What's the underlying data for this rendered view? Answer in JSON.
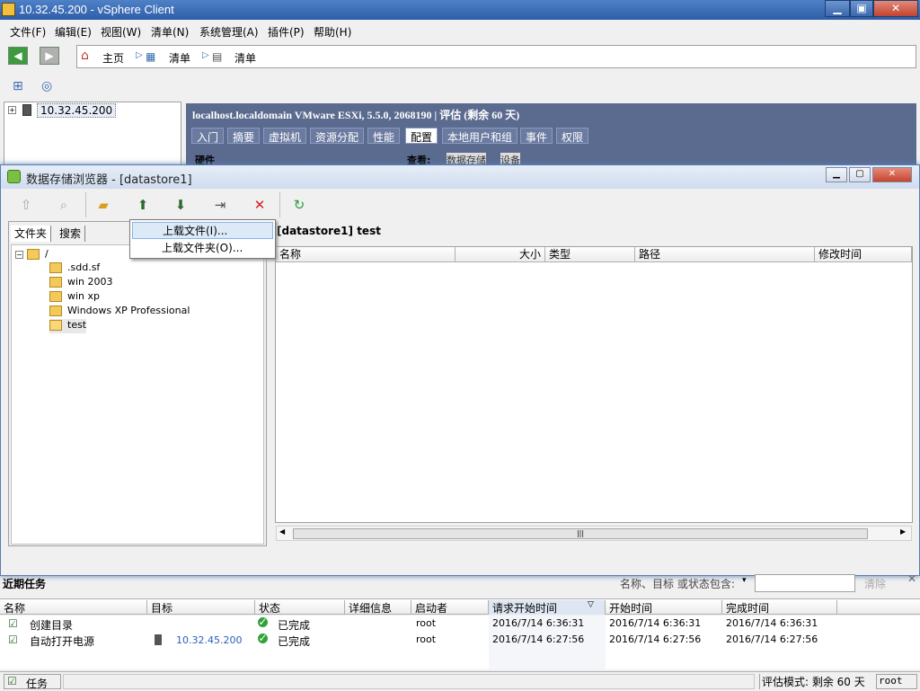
{
  "window": {
    "title": "10.32.45.200 - vSphere Client",
    "min": "▁",
    "max": "▣",
    "close": "✕"
  },
  "menu": [
    "文件(F)",
    "编辑(E)",
    "视图(W)",
    "清单(N)",
    "系统管理(A)",
    "插件(P)",
    "帮助(H)"
  ],
  "nav": {
    "home": "主页",
    "crumb1": "清单",
    "crumb2": "清单"
  },
  "inventory": {
    "host": "10.32.45.200"
  },
  "host_header": {
    "title": "localhost.localdomain VMware ESXi, 5.5.0, 2068190 | 评估 (剩余 60 天)",
    "tabs": [
      "入门",
      "摘要",
      "虚拟机",
      "资源分配",
      "性能",
      "配置",
      "本地用户和组",
      "事件",
      "权限"
    ],
    "selected_tab": "配置",
    "hw": "硬件",
    "view": "查看:",
    "view_opt1": "数据存储",
    "view_opt2": "设备"
  },
  "dialog": {
    "title": "数据存储浏览器 - [datastore1]",
    "tab_folders": "文件夹",
    "tab_search": "搜索",
    "path": "[datastore1] test",
    "root": "/",
    "folders": [
      ".sdd.sf",
      "win 2003",
      "win xp",
      "Windows XP Professional",
      "test"
    ],
    "columns": [
      "名称",
      "大小",
      "类型",
      "路径",
      "修改时间"
    ]
  },
  "upload_menu": {
    "items": [
      "上载文件(I)...",
      "上载文件夹(O)..."
    ]
  },
  "tasks": {
    "title": "近期任务",
    "filter_label": "名称、目标 或状态包含:",
    "clear": "清除",
    "columns": [
      "名称",
      "目标",
      "状态",
      "详细信息",
      "启动者",
      "请求开始时间",
      "开始时间",
      "完成时间"
    ],
    "rows": [
      {
        "name": "创建目录",
        "target": "",
        "status": "已完成",
        "details": "",
        "initiator": "root",
        "requested": "2016/7/14 6:36:31",
        "start": "2016/7/14 6:36:31",
        "end": "2016/7/14 6:36:31"
      },
      {
        "name": "自动打开电源",
        "target": "10.32.45.200",
        "status": "已完成",
        "details": "",
        "initiator": "root",
        "requested": "2016/7/14 6:27:56",
        "start": "2016/7/14 6:27:56",
        "end": "2016/7/14 6:27:56"
      }
    ]
  },
  "status": {
    "tasks": "任务",
    "eval": "评估模式: 剩余 60 天",
    "user": "root"
  }
}
